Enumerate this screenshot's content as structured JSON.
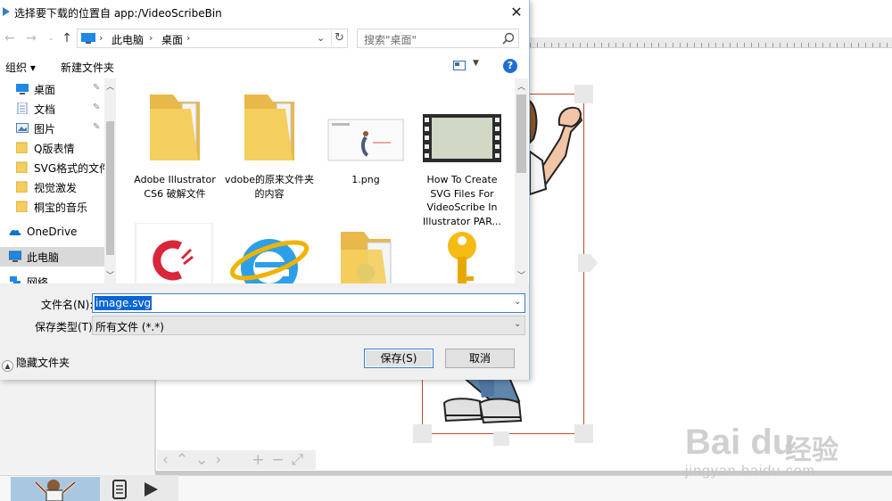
{
  "dialog": {
    "title": "选择要下载的位置自 app:/VideoScribeBin",
    "address": [
      "此电脑",
      "桌面"
    ],
    "search_placeholder": "搜索\"桌面\"",
    "toolbar": {
      "organize": "组织 ▾",
      "new_folder": "新建文件夹"
    },
    "nav_items": [
      {
        "label": "桌面",
        "icon": "desktop-icon",
        "pinned": true
      },
      {
        "label": "文档",
        "icon": "documents-icon",
        "pinned": true
      },
      {
        "label": "图片",
        "icon": "pictures-icon",
        "pinned": true
      },
      {
        "label": "Q版表情",
        "icon": "folder-icon"
      },
      {
        "label": "SVG格式的文件",
        "icon": "folder-icon"
      },
      {
        "label": "视觉激发",
        "icon": "folder-icon"
      },
      {
        "label": "桐宝的音乐",
        "icon": "folder-icon"
      },
      {
        "label": "OneDrive",
        "icon": "onedrive-icon"
      },
      {
        "label": "此电脑",
        "icon": "pc-icon",
        "selected": true
      },
      {
        "label": "网络",
        "icon": "network-icon"
      }
    ],
    "files": [
      {
        "name": "Adobe Illustrator CS6 破解文件",
        "type": "folder"
      },
      {
        "name": "vdobe的原来文件夹的内容",
        "type": "folder"
      },
      {
        "name": "1.png",
        "type": "image"
      },
      {
        "name": "How To Create SVG Files For VideoScribe In Illustrator PAR...",
        "type": "video"
      },
      {
        "name": "",
        "type": "app-shortcut"
      },
      {
        "name": "",
        "type": "ie-shortcut"
      },
      {
        "name": "",
        "type": "folder-ie"
      },
      {
        "name": "",
        "type": "key-shortcut"
      }
    ],
    "filename_label": "文件名(N):",
    "filename_value": "image.svg",
    "filetype_label": "保存类型(T):",
    "filetype_value": "所有文件 (*.*)",
    "hide_folders": "隐藏文件夹",
    "save": "保存(S)",
    "cancel": "取消",
    "close_glyph": "✕",
    "help_glyph": "?"
  },
  "watermark": {
    "brand": "Bai du",
    "product": "经验",
    "url": "jingyan.baidu.com"
  },
  "colors": {
    "accent": "#0a65d3",
    "frame": "#c0482d",
    "folder": "#f5cf5d"
  }
}
